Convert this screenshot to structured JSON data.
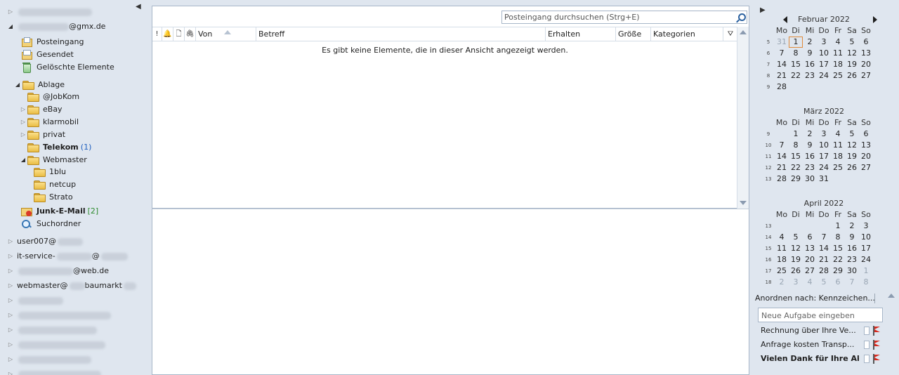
{
  "navigation": {
    "accounts": [
      {
        "label": "",
        "expanded": false
      },
      {
        "label": "@gmx.de",
        "expanded": true
      }
    ],
    "folders": {
      "inbox": "Posteingang",
      "sent": "Gesendet",
      "deleted": "Gelöschte Elemente",
      "archive": "Ablage",
      "jobkom": "@JobKom",
      "ebay": "eBay",
      "klarmobil": "klarmobil",
      "privat": "privat",
      "telekom": "Telekom",
      "telekom_count": "(1)",
      "webmaster": "Webmaster",
      "blu": "1blu",
      "netcup": "netcup",
      "strato": "Strato",
      "junk": "Junk-E-Mail",
      "junk_count": "[2]",
      "search_folders": "Suchordner"
    },
    "other_accounts": [
      "user007@",
      "it-service-",
      "@",
      "@web.de",
      "webmaster@",
      "baumarkt"
    ]
  },
  "list": {
    "search_placeholder": "Posteingang durchsuchen (Strg+E)",
    "columns": {
      "importance": "!",
      "reminder": "🔔",
      "type": "🗋",
      "attachment": "🖇",
      "from": "Von",
      "subject": "Betreff",
      "received": "Erhalten",
      "size": "Größe",
      "categories": "Kategorien",
      "filter": "⛛"
    },
    "empty_message": "Es gibt keine Elemente, die in dieser Ansicht angezeigt werden."
  },
  "todo": {
    "weekdays": [
      "Mo",
      "Di",
      "Mi",
      "Do",
      "Fr",
      "Sa",
      "So"
    ],
    "calendars": [
      {
        "title": "Februar 2022",
        "weeks": [
          "5",
          "6",
          "7",
          "8",
          "9"
        ],
        "rows": [
          [
            "31",
            "1",
            "2",
            "3",
            "4",
            "5",
            "6"
          ],
          [
            "7",
            "8",
            "9",
            "10",
            "11",
            "12",
            "13"
          ],
          [
            "14",
            "15",
            "16",
            "17",
            "18",
            "19",
            "20"
          ],
          [
            "21",
            "22",
            "23",
            "24",
            "25",
            "26",
            "27"
          ],
          [
            "28",
            "",
            "",
            "",
            "",
            "",
            ""
          ]
        ],
        "other_month": [
          [
            0,
            0
          ]
        ],
        "today": [
          0,
          1
        ]
      },
      {
        "title": "März 2022",
        "weeks": [
          "9",
          "10",
          "11",
          "12",
          "13"
        ],
        "rows": [
          [
            "",
            "1",
            "2",
            "3",
            "4",
            "5",
            "6"
          ],
          [
            "7",
            "8",
            "9",
            "10",
            "11",
            "12",
            "13"
          ],
          [
            "14",
            "15",
            "16",
            "17",
            "18",
            "19",
            "20"
          ],
          [
            "21",
            "22",
            "23",
            "24",
            "25",
            "26",
            "27"
          ],
          [
            "28",
            "29",
            "30",
            "31",
            "",
            "",
            ""
          ]
        ],
        "other_month": []
      },
      {
        "title": "April 2022",
        "weeks": [
          "13",
          "14",
          "15",
          "16",
          "17",
          "18"
        ],
        "rows": [
          [
            "",
            "",
            "",
            "",
            "1",
            "2",
            "3"
          ],
          [
            "4",
            "5",
            "6",
            "7",
            "8",
            "9",
            "10"
          ],
          [
            "11",
            "12",
            "13",
            "14",
            "15",
            "16",
            "17"
          ],
          [
            "18",
            "19",
            "20",
            "21",
            "22",
            "23",
            "24"
          ],
          [
            "25",
            "26",
            "27",
            "28",
            "29",
            "30",
            "1"
          ],
          [
            "2",
            "3",
            "4",
            "5",
            "6",
            "7",
            "8"
          ]
        ],
        "other_month": [
          [
            4,
            6
          ],
          [
            5,
            0
          ],
          [
            5,
            1
          ],
          [
            5,
            2
          ],
          [
            5,
            3
          ],
          [
            5,
            4
          ],
          [
            5,
            5
          ],
          [
            5,
            6
          ]
        ]
      }
    ],
    "arrange_by": "Anordnen nach: Kennzeichen...",
    "new_task_placeholder": "Neue Aufgabe eingeben",
    "tasks": [
      {
        "label": "Rechnung über Ihre Ve...",
        "bold": false
      },
      {
        "label": "Anfrage kosten Transp...",
        "bold": false
      },
      {
        "label": "Vielen Dank für Ihre Ak...",
        "bold": true
      }
    ],
    "accent_color": "#e08a3a",
    "flag_color": "#d92a1f"
  }
}
